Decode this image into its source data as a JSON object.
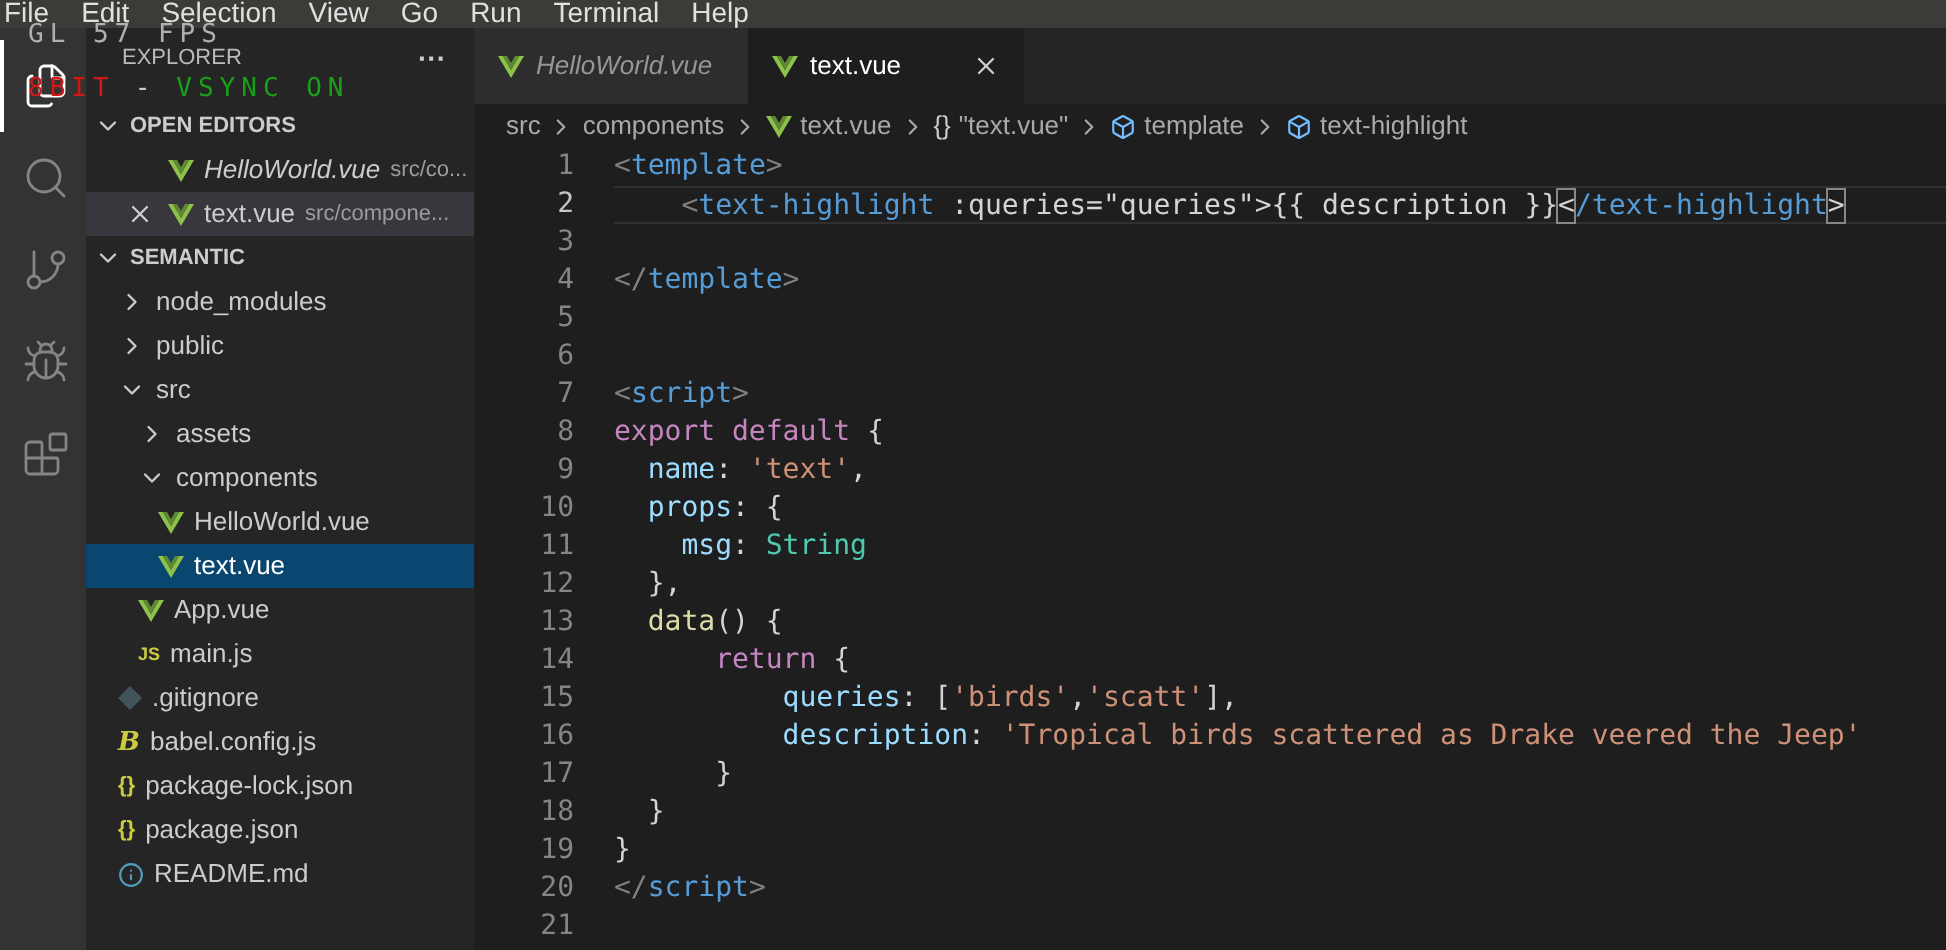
{
  "menu_bar": [
    "File",
    "Edit",
    "Selection",
    "View",
    "Go",
    "Run",
    "Terminal",
    "Help"
  ],
  "overlay": {
    "fps": "GL 57 FPS",
    "segments": [
      {
        "text": "8BIT",
        "color": "#d01818"
      },
      {
        "text": "-",
        "color": "#d0d0d0"
      },
      {
        "text": "VSYNC ON",
        "color": "#18a018"
      }
    ]
  },
  "activity_bar": [
    {
      "kind": "files",
      "selected": true
    },
    {
      "kind": "search",
      "selected": false
    },
    {
      "kind": "git",
      "selected": false
    },
    {
      "kind": "debug",
      "selected": false
    },
    {
      "kind": "extensions",
      "selected": false
    }
  ],
  "sidebar": {
    "title": "EXPLORER",
    "more": "···",
    "open_editors": {
      "title": "OPEN EDITORS",
      "expanded": true,
      "items": [
        {
          "name": "HelloWorld.vue",
          "path": "src/co...",
          "italic": true,
          "selected": false
        },
        {
          "name": "text.vue",
          "path": "src/compone...",
          "italic": false,
          "selected": true
        }
      ]
    },
    "folder": {
      "title": "SEMANTIC",
      "expanded": true,
      "tree": [
        {
          "name": "node_modules",
          "kind": "folder",
          "expanded": false,
          "selected": false
        },
        {
          "name": "public",
          "kind": "folder",
          "expanded": false,
          "selected": false
        },
        {
          "name": "src",
          "kind": "folder",
          "expanded": true,
          "selected": false,
          "children": [
            {
              "name": "assets",
              "kind": "folder",
              "expanded": false,
              "selected": false
            },
            {
              "name": "components",
              "kind": "folder",
              "expanded": true,
              "selected": false,
              "children": [
                {
                  "name": "HelloWorld.vue",
                  "kind": "vue",
                  "selected": false
                },
                {
                  "name": "text.vue",
                  "kind": "vue",
                  "selected": true
                }
              ]
            },
            {
              "name": "App.vue",
              "kind": "vue",
              "selected": false
            },
            {
              "name": "main.js",
              "kind": "js",
              "icon": "JS",
              "selected": false
            }
          ]
        },
        {
          "name": ".gitignore",
          "kind": "git",
          "selected": false
        },
        {
          "name": "babel.config.js",
          "kind": "babel",
          "icon": "B",
          "selected": false
        },
        {
          "name": "package-lock.json",
          "kind": "json",
          "icon": "{}",
          "selected": false
        },
        {
          "name": "package.json",
          "kind": "json",
          "icon": "{}",
          "selected": false
        },
        {
          "name": "README.md",
          "kind": "info",
          "selected": false
        }
      ]
    }
  },
  "tabs": [
    {
      "label": "HelloWorld.vue",
      "italic": true,
      "selected": false
    },
    {
      "label": "text.vue",
      "italic": false,
      "selected": true
    }
  ],
  "breadcrumbs": [
    {
      "kind": "text",
      "label": "src"
    },
    {
      "kind": "text",
      "label": "components"
    },
    {
      "kind": "vue",
      "label": "text.vue"
    },
    {
      "kind": "braces",
      "icon": "{}",
      "label": "\"text.vue\""
    },
    {
      "kind": "element",
      "label": "template"
    },
    {
      "kind": "element",
      "label": "text-highlight"
    }
  ],
  "editor": {
    "lines": [
      {
        "number": "1",
        "current": false,
        "tokens": [
          {
            "text": "<",
            "kind": "punct"
          },
          {
            "text": "template",
            "kind": "tag"
          },
          {
            "text": ">",
            "kind": "punct"
          }
        ]
      },
      {
        "number": "2",
        "current": true,
        "tokens": [
          {
            "text": "    <",
            "kind": "punct"
          },
          {
            "text": "text-highlight",
            "kind": "tag"
          },
          {
            "text": " :queries=\"queries\"",
            "kind": "plain"
          },
          {
            "text": ">{{ description }}",
            "kind": "plain"
          },
          {
            "text": "<",
            "kind": "bracket"
          },
          {
            "text": "/text-highlight",
            "kind": "tag"
          },
          {
            "text": ">",
            "kind": "bracket"
          }
        ]
      },
      {
        "number": "3",
        "current": false
      },
      {
        "number": "4",
        "current": false,
        "tokens": [
          {
            "text": "</",
            "kind": "punct"
          },
          {
            "text": "template",
            "kind": "tag"
          },
          {
            "text": ">",
            "kind": "punct"
          }
        ]
      },
      {
        "number": "5",
        "current": false
      },
      {
        "number": "6",
        "current": false
      },
      {
        "number": "7",
        "current": false,
        "tokens": [
          {
            "text": "<",
            "kind": "punct"
          },
          {
            "text": "script",
            "kind": "tag"
          },
          {
            "text": ">",
            "kind": "punct"
          }
        ]
      },
      {
        "number": "8",
        "current": false,
        "tokens": [
          {
            "text": "export default",
            "kind": "keyword"
          },
          {
            "text": " {",
            "kind": "plain"
          }
        ]
      },
      {
        "number": "9",
        "current": false,
        "tokens": [
          {
            "text": "  name",
            "kind": "prop"
          },
          {
            "text": ": ",
            "kind": "plain"
          },
          {
            "text": "'text'",
            "kind": "string"
          },
          {
            "text": ",",
            "kind": "plain"
          }
        ]
      },
      {
        "number": "10",
        "current": false,
        "tokens": [
          {
            "text": "  props",
            "kind": "prop"
          },
          {
            "text": ": {",
            "kind": "plain"
          }
        ]
      },
      {
        "number": "11",
        "current": false,
        "tokens": [
          {
            "text": "    msg",
            "kind": "prop"
          },
          {
            "text": ": ",
            "kind": "plain"
          },
          {
            "text": "String",
            "kind": "type"
          }
        ]
      },
      {
        "number": "12",
        "current": false,
        "tokens": [
          {
            "text": "  },",
            "kind": "plain"
          }
        ]
      },
      {
        "number": "13",
        "current": false,
        "tokens": [
          {
            "text": "  data",
            "kind": "func"
          },
          {
            "text": "() {",
            "kind": "plain"
          }
        ]
      },
      {
        "number": "14",
        "current": false,
        "tokens": [
          {
            "text": "      return",
            "kind": "keyword"
          },
          {
            "text": " {",
            "kind": "plain"
          }
        ]
      },
      {
        "number": "15",
        "current": false,
        "tokens": [
          {
            "text": "          queries",
            "kind": "prop"
          },
          {
            "text": ": [",
            "kind": "plain"
          },
          {
            "text": "'birds'",
            "kind": "string"
          },
          {
            "text": ",",
            "kind": "plain"
          },
          {
            "text": "'scatt'",
            "kind": "string"
          },
          {
            "text": "],",
            "kind": "plain"
          }
        ]
      },
      {
        "number": "16",
        "current": false,
        "tokens": [
          {
            "text": "          description",
            "kind": "prop"
          },
          {
            "text": ": ",
            "kind": "plain"
          },
          {
            "text": "'Tropical birds scattered as Drake veered the Jeep'",
            "kind": "string"
          }
        ]
      },
      {
        "number": "17",
        "current": false,
        "tokens": [
          {
            "text": "      }",
            "kind": "plain"
          }
        ]
      },
      {
        "number": "18",
        "current": false,
        "tokens": [
          {
            "text": "  }",
            "kind": "plain"
          }
        ]
      },
      {
        "number": "19",
        "current": false,
        "tokens": [
          {
            "text": "}",
            "kind": "plain"
          }
        ]
      },
      {
        "number": "20",
        "current": false,
        "tokens": [
          {
            "text": "</",
            "kind": "punct"
          },
          {
            "text": "script",
            "kind": "tag"
          },
          {
            "text": ">",
            "kind": "punct"
          }
        ]
      },
      {
        "number": "21",
        "current": false
      }
    ]
  }
}
